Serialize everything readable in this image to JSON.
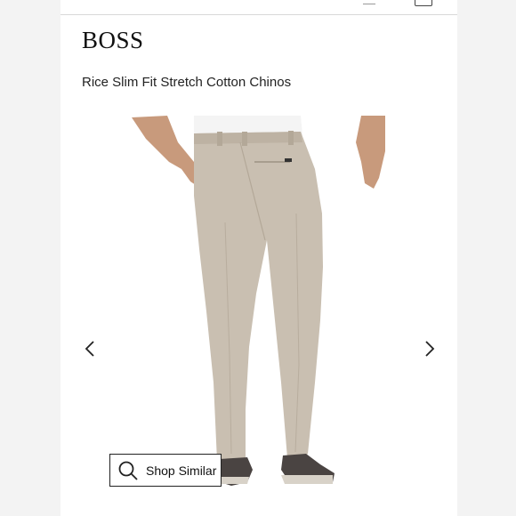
{
  "header": {
    "brand": "BOSS",
    "product_title": "Rice Slim Fit Stretch Cotton Chinos"
  },
  "gallery": {
    "prev_icon": "chevron-left-icon",
    "next_icon": "chevron-right-icon",
    "image_alt": "Product photo of khaki chinos"
  },
  "actions": {
    "shop_similar_label": "Shop Similar",
    "shop_similar_icon": "search-icon"
  },
  "colors": {
    "chino": "#c9bfb1",
    "shirt": "#f4f4f4",
    "skin": "#c89a7c",
    "shoe": "#4a4442"
  }
}
